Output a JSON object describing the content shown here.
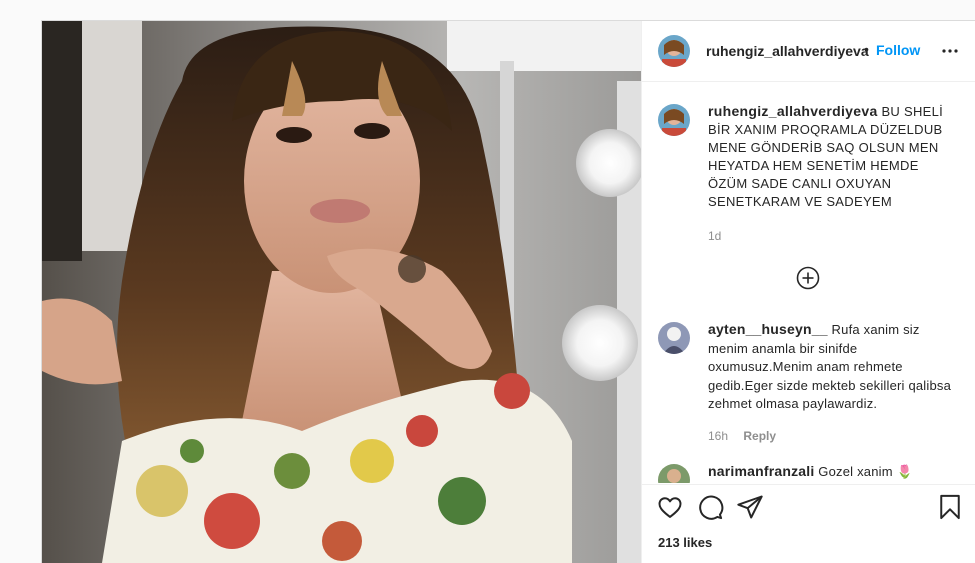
{
  "colors": {
    "follow": "#0095f6",
    "text": "#262626",
    "muted": "#8e8e8e",
    "divider": "#efefef"
  },
  "post": {
    "author": "ruhengiz_allahverdiyeva",
    "separator": "•",
    "follow_label": "Follow",
    "more_icon": "more-options-icon"
  },
  "caption": {
    "username": "ruhengiz_allahverdiyeva",
    "text": "BU SHELİ BİR XANIM PROQRAMLA DÜZELDUB MENE GÖNDERİB SAQ OLSUN MEN HEYATDA HEM SENETİM HEMDE ÖZÜM SADE CANLI OXUYAN SENETKARAM VE SADEYEM",
    "time": "1d",
    "load_more_icon": "plus-circle-icon"
  },
  "comments": [
    {
      "username": "ayten__huseyn__",
      "text": "Rufa xanim siz menim anamla bir sinifde oxumusuz.Menim anam rehmete gedib.Eger sizde mekteb sekilleri qalibsa zehmet olmasa paylawardiz.",
      "time": "16h",
      "reply_label": "Reply"
    },
    {
      "username": "narimanfranzali",
      "text": "Gozel xanim 🌷"
    }
  ],
  "actions": {
    "like_icon": "heart-icon",
    "comment_icon": "comment-icon",
    "share_icon": "share-icon",
    "save_icon": "bookmark-icon",
    "likes_text": "213 likes"
  }
}
